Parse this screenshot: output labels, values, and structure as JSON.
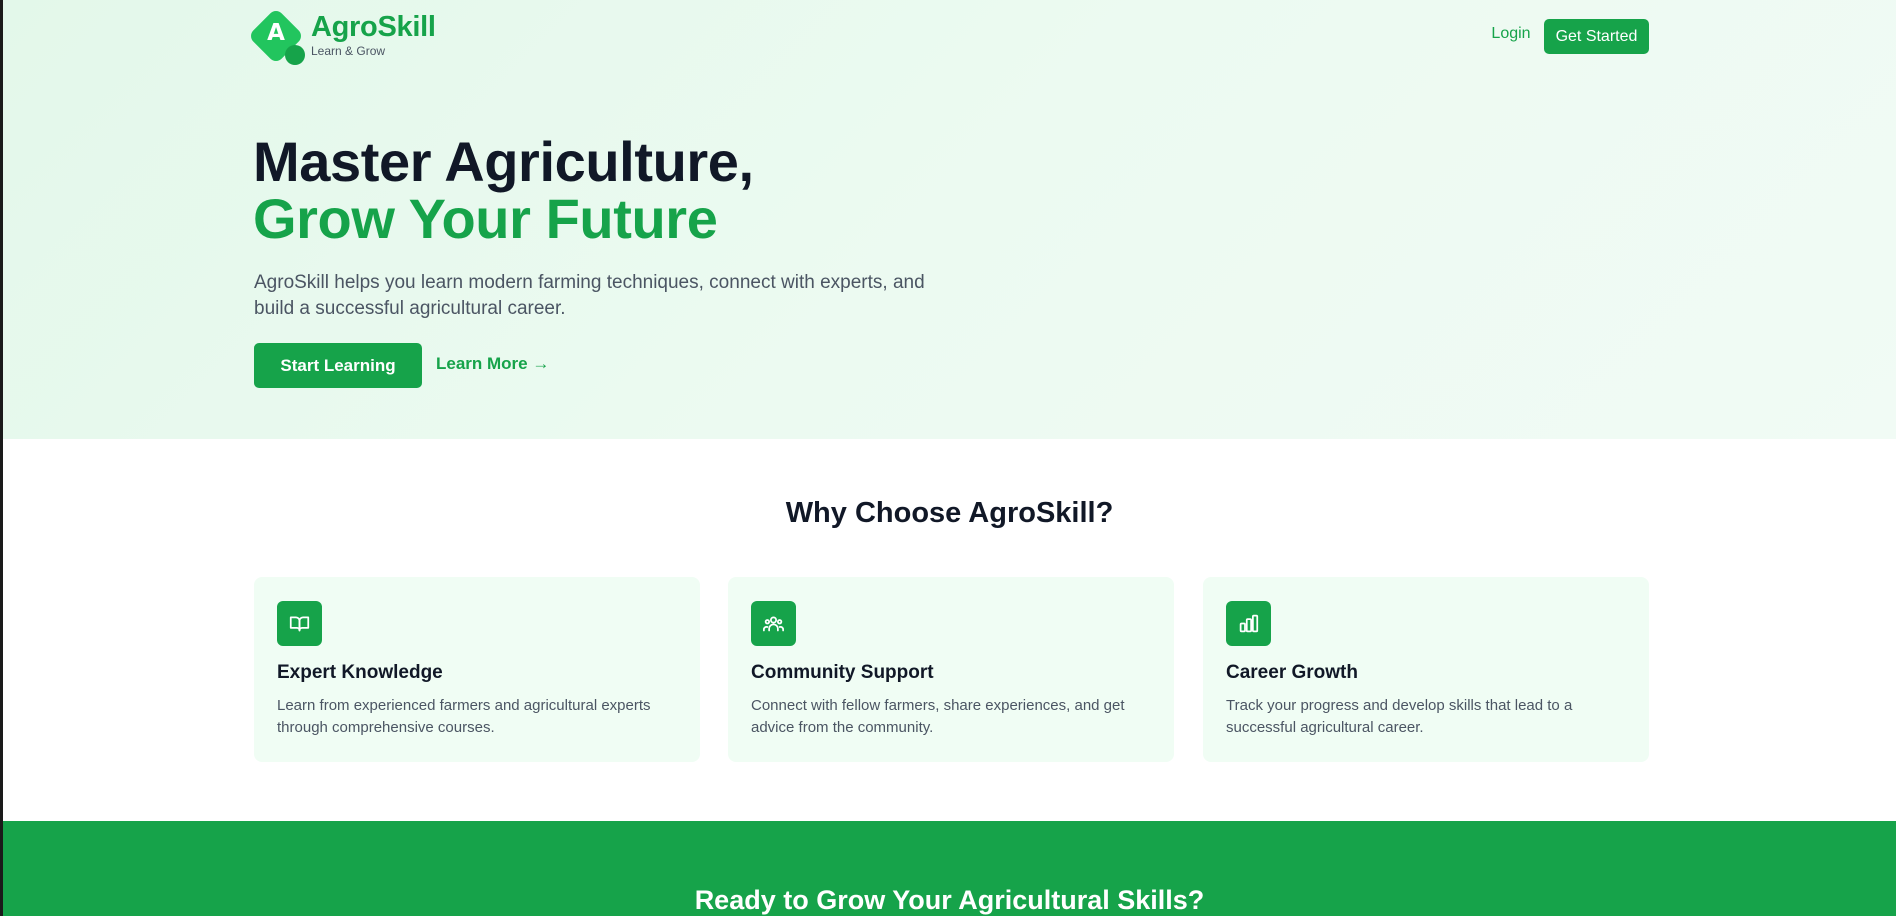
{
  "brand": {
    "name": "AgroSkill",
    "tagline": "Learn & Grow",
    "logo_letter": "A",
    "primary_color": "#16a34a",
    "accent_color": "#22c55e"
  },
  "nav": {
    "login_label": "Login",
    "cta_label": "Get Started"
  },
  "hero": {
    "title_line1": "Master Agriculture,",
    "title_line2": "Grow Your Future",
    "description": "AgroSkill helps you learn modern farming techniques, connect with experts, and build a successful agricultural career.",
    "primary_button": "Start Learning",
    "secondary_button": "Learn More →"
  },
  "features": {
    "heading": "Why Choose AgroSkill?",
    "items": [
      {
        "icon": "book-icon",
        "title": "Expert Knowledge",
        "description": "Learn from experienced farmers and agricultural experts through comprehensive courses."
      },
      {
        "icon": "users-icon",
        "title": "Community Support",
        "description": "Connect with fellow farmers, share experiences, and get advice from the community."
      },
      {
        "icon": "chart-icon",
        "title": "Career Growth",
        "description": "Track your progress and develop skills that lead to a successful agricultural career."
      }
    ]
  },
  "cta": {
    "heading": "Ready to Grow Your Agricultural Skills?"
  }
}
